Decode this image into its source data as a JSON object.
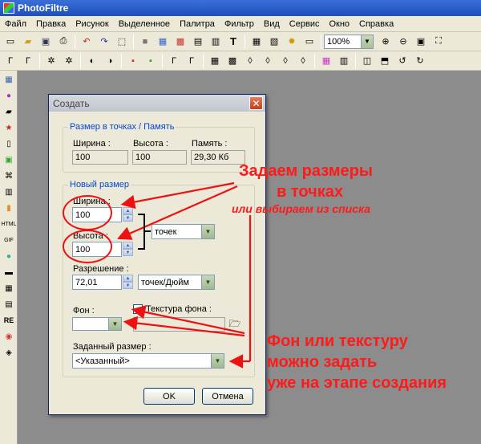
{
  "app": {
    "title": "PhotoFiltre"
  },
  "menu": [
    "Файл",
    "Правка",
    "Рисунок",
    "Выделенное",
    "Палитра",
    "Фильтр",
    "Вид",
    "Сервис",
    "Окно",
    "Справка"
  ],
  "toolbar": {
    "zoom_value": "100%"
  },
  "dialog": {
    "title": "Создать",
    "size_group": {
      "label": "Размер в точках / Память",
      "width_label": "Ширина :",
      "width_value": "100",
      "height_label": "Высота :",
      "height_value": "100",
      "memory_label": "Память :",
      "memory_value": "29,30 Кб"
    },
    "new_size_group": {
      "label": "Новый размер",
      "width_label": "Ширина :",
      "width_value": "100",
      "height_label": "Высота :",
      "height_value": "100",
      "unit_value": "точек",
      "resolution_label": "Разрешение :",
      "resolution_value": "72,01",
      "resolution_unit": "точек/Дюйм",
      "background_label": "Фон :",
      "texture_label": "Текстура фона :",
      "preset_label": "Заданный размер :",
      "preset_value": "<Указанный>"
    },
    "ok_label": "OK",
    "cancel_label": "Отмена"
  },
  "annotations": {
    "line1": "Задаем размеры",
    "line2": "в точках",
    "line3": "или выбираем из списка",
    "line4": "Фон или текстуру",
    "line5": "можно задать",
    "line6": "уже на этапе создания"
  },
  "colors": {
    "annotation": "#ff1a1a",
    "workspace": "#8c8c8c",
    "titlebar": "#1f4fb8"
  }
}
